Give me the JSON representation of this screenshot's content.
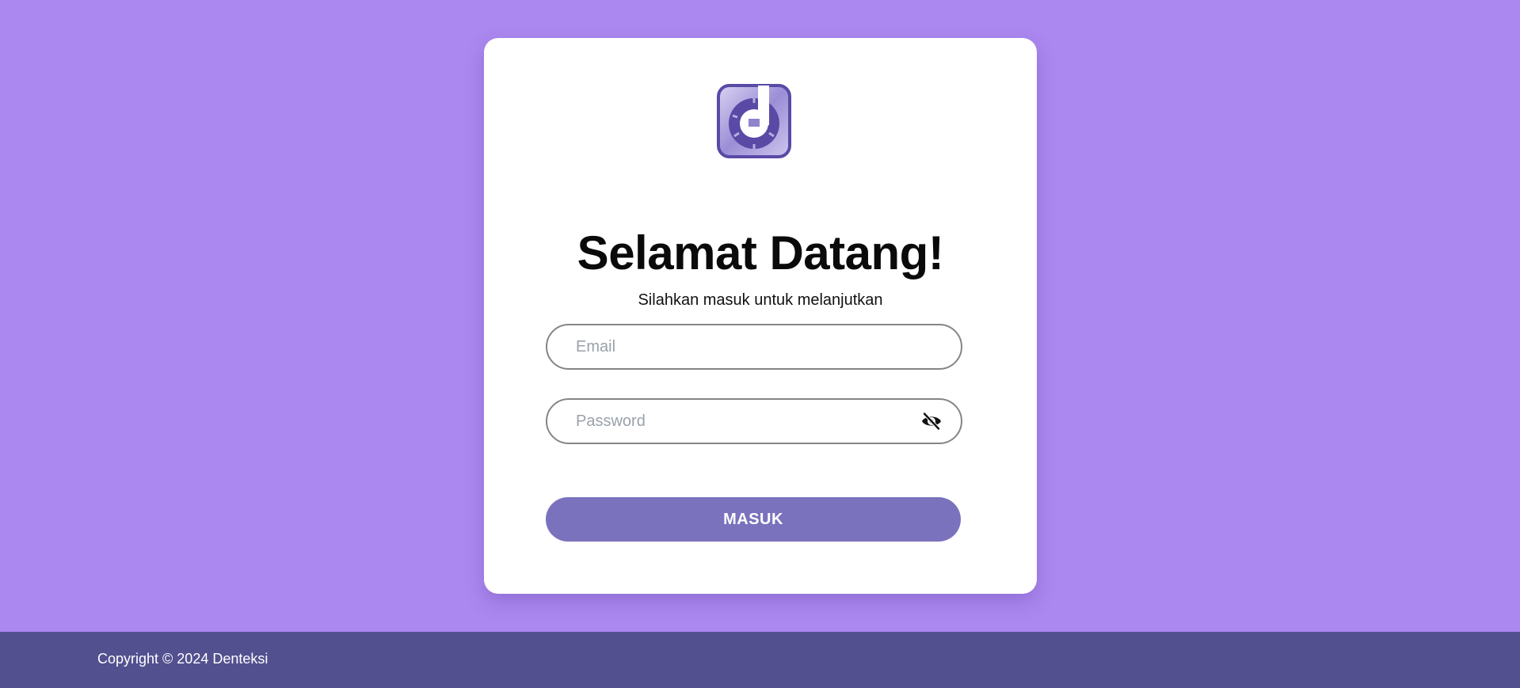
{
  "colors": {
    "background": "#ab88ef",
    "card": "#ffffff",
    "button": "#7a72bd",
    "footer": "#53508f",
    "logo": "#5a4aa6"
  },
  "logo": {
    "icon": "denteksi-logo-icon"
  },
  "login": {
    "title": "Selamat Datang!",
    "subtitle": "Silahkan masuk untuk melanjutkan",
    "email": {
      "placeholder": "Email",
      "value": ""
    },
    "password": {
      "placeholder": "Password",
      "value": "",
      "toggle_icon": "eye-slash-icon"
    },
    "submit_label": "MASUK"
  },
  "footer": {
    "copyright": "Copyright © 2024 Denteksi"
  }
}
